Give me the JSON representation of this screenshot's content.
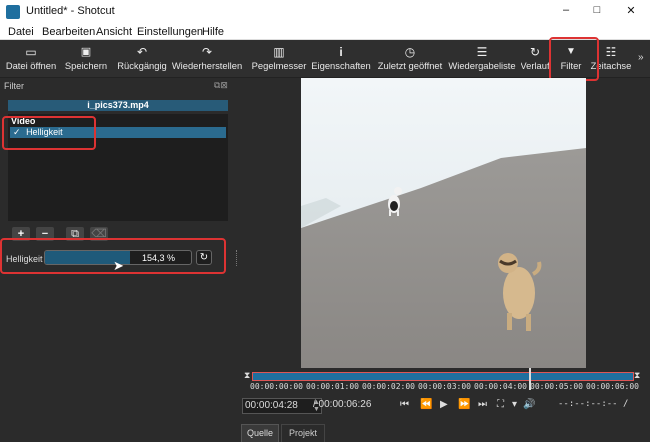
{
  "window": {
    "title": "Untitled* - Shotcut",
    "minimize": "–",
    "maximize": "□",
    "close": "✕"
  },
  "menu": [
    "Datei",
    "Bearbeiten",
    "Ansicht",
    "Einstellungen",
    "Hilfe"
  ],
  "toolbar": [
    {
      "label": "Datei öffnen",
      "icon": "folder-icon",
      "glyph": "▭"
    },
    {
      "label": "Speichern",
      "icon": "save-icon",
      "glyph": "💾"
    },
    {
      "label": "Rückgängig",
      "icon": "undo-icon",
      "glyph": "↶"
    },
    {
      "label": "Wiederherstellen",
      "icon": "redo-icon",
      "glyph": "↷"
    },
    {
      "label": "Pegelmesser",
      "icon": "meter-icon",
      "glyph": "▥"
    },
    {
      "label": "Eigenschaften",
      "icon": "info-icon",
      "glyph": "i"
    },
    {
      "label": "Zuletzt geöffnet",
      "icon": "clock-icon",
      "glyph": "◷"
    },
    {
      "label": "Wiedergabeliste",
      "icon": "list-icon",
      "glyph": "☰"
    },
    {
      "label": "Verlauf",
      "icon": "history-icon",
      "glyph": "↻"
    },
    {
      "label": "Filter",
      "icon": "filter-icon",
      "glyph": "▼"
    },
    {
      "label": "Zeitachse",
      "icon": "timeline-icon",
      "glyph": "☷"
    }
  ],
  "filter_panel": {
    "title": "Filter",
    "file": "i_pics373.mp4",
    "section": "Video",
    "filter_item": "Helligkeit",
    "checkmark": "✓",
    "buttons": [
      "+",
      "−",
      "⧉",
      "⌫"
    ],
    "param_label": "Helligkeit",
    "param_value": "154,3 %",
    "param_fill": 0.58,
    "reset_glyph": "↻"
  },
  "timeline": {
    "ticks": [
      "00:00:00:00",
      "00:00:01:00",
      "00:00:02:00",
      "00:00:03:00",
      "00:00:04:00",
      "00:00:05:00",
      "00:00:06:00"
    ],
    "playhead_fraction": 0.725
  },
  "transport": {
    "current": "00:00:04:28",
    "duration": "/ 00:00:06:26",
    "inout": "--:--:--:-- /",
    "controls": [
      "⏮",
      "⏪",
      "▶",
      "⏩",
      "⏭",
      "⛶",
      "▾",
      "🔊"
    ]
  },
  "tabs": [
    "Quelle",
    "Projekt"
  ]
}
